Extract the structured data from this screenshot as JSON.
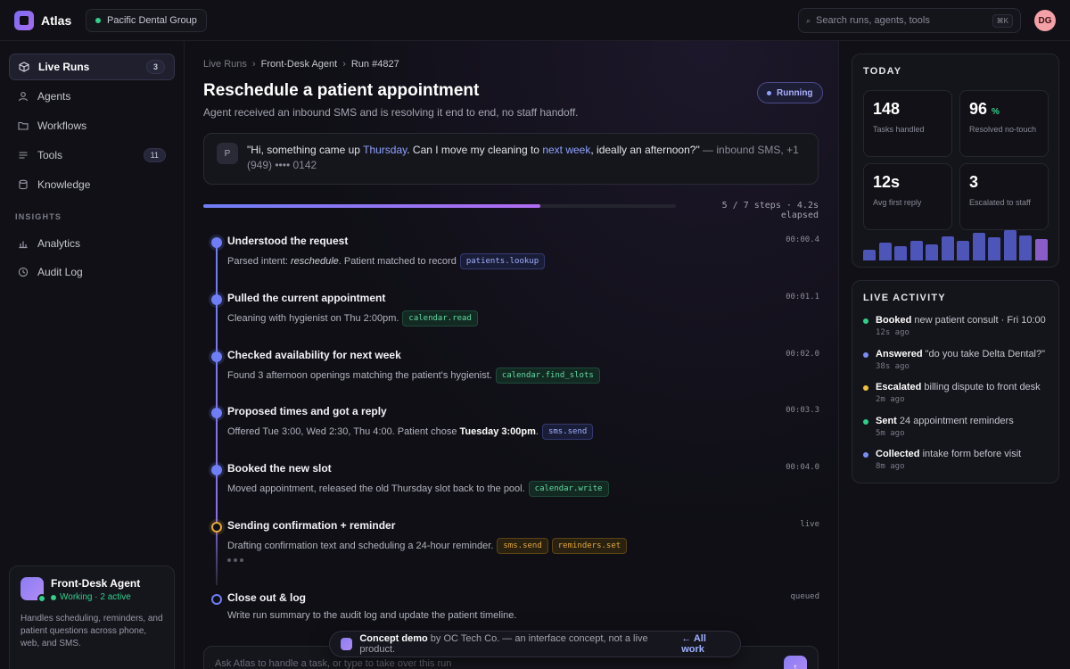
{
  "app": {
    "name": "Atlas",
    "avatar_initials": "DG"
  },
  "org": {
    "name": "Pacific Dental Group",
    "status_color": "#2fd08a"
  },
  "search": {
    "placeholder": "Search runs, agents, tools",
    "shortcut": "⌘K"
  },
  "sidebar": {
    "items": [
      {
        "label": "Live Runs",
        "icon": "cube-icon",
        "count": "3"
      },
      {
        "label": "Agents",
        "icon": "user-icon"
      },
      {
        "label": "Workflows",
        "icon": "folder-icon"
      },
      {
        "label": "Tools",
        "icon": "list-icon",
        "count": "11"
      },
      {
        "label": "Knowledge",
        "icon": "database-icon"
      }
    ],
    "section_insights": "INSIGHTS",
    "insights": [
      {
        "label": "Analytics",
        "icon": "bar-chart-icon"
      },
      {
        "label": "Audit Log",
        "icon": "clock-icon"
      }
    ],
    "agent_card": {
      "name": "Front-Desk Agent",
      "status": "Working · 2 active",
      "description": "Handles scheduling, reminders, and patient questions across phone, web, and SMS."
    }
  },
  "breadcrumb": [
    "Live Runs",
    "Front-Desk Agent",
    "Run #4827"
  ],
  "run": {
    "title": "Reschedule a patient appointment",
    "subtitle": "Agent received an inbound SMS and is resolving it end to end, no staff handoff.",
    "status": "Running",
    "message": {
      "avatar": "P",
      "part1": "\"Hi, something came up ",
      "hl1": "Thursday",
      "part2": ". Can I move my cleaning to ",
      "hl2": "next week",
      "part3": ", ideally an afternoon?\"",
      "meta": " — inbound SMS, +1 (949) •••• 0142"
    },
    "progress": {
      "value": 0.714,
      "text": "5 / 7 steps · 4.2s elapsed"
    }
  },
  "steps": [
    {
      "title": "Understood the request",
      "time": "00:00.4",
      "state": "done",
      "desc_pre": "Parsed intent: ",
      "desc_em": "reschedule",
      "desc_post": ". Patient matched to record",
      "chips": [
        {
          "label": "patients.lookup",
          "tone": "blue"
        }
      ]
    },
    {
      "title": "Pulled the current appointment",
      "time": "00:01.1",
      "state": "done",
      "desc_pre": "Cleaning with hygienist on Thu 2:00pm.",
      "chips": [
        {
          "label": "calendar.read",
          "tone": "green"
        }
      ]
    },
    {
      "title": "Checked availability for next week",
      "time": "00:02.0",
      "state": "done",
      "desc_pre": "Found 3 afternoon openings matching the patient's hygienist.",
      "chips": [
        {
          "label": "calendar.find_slots",
          "tone": "green"
        }
      ]
    },
    {
      "title": "Proposed times and got a reply",
      "time": "00:03.3",
      "state": "done",
      "desc_pre": "Offered Tue 3:00, Wed 2:30, Thu 4:00. Patient chose ",
      "desc_bold": "Tuesday 3:00pm",
      "desc_post": ".",
      "chips": [
        {
          "label": "sms.send",
          "tone": "blue"
        }
      ]
    },
    {
      "title": "Booked the new slot",
      "time": "00:04.0",
      "state": "done",
      "desc_pre": "Moved appointment, released the old Thursday slot back to the pool.",
      "chips": [
        {
          "label": "calendar.write",
          "tone": "green"
        }
      ]
    },
    {
      "title": "Sending confirmation + reminder",
      "time": "live",
      "state": "live",
      "desc_pre": "Drafting confirmation text and scheduling a 24-hour reminder.",
      "chips": [
        {
          "label": "sms.send",
          "tone": "amber"
        },
        {
          "label": "reminders.set",
          "tone": "amber"
        }
      ]
    },
    {
      "title": "Close out & log",
      "time": "queued",
      "state": "queued",
      "desc_pre": "Write run summary to the audit log and update the patient timeline.",
      "chips": []
    }
  ],
  "composer": {
    "placeholder": "Ask Atlas to handle a task, or type to take over this run"
  },
  "demo_banner": {
    "bold": "Concept demo",
    "text": " by OC Tech Co. — an interface concept, not a live product.",
    "link": "← All work"
  },
  "today": {
    "title": "TODAY",
    "stats": [
      {
        "value": "148",
        "label": "Tasks handled"
      },
      {
        "value": "96",
        "unit": "%",
        "label": "Resolved no-touch"
      },
      {
        "value": "12s",
        "label": "Avg first reply"
      },
      {
        "value": "3",
        "label": "Escalated to staff"
      }
    ],
    "bar_values": [
      0.33,
      0.55,
      0.45,
      0.62,
      0.5,
      0.75,
      0.6,
      0.85,
      0.72,
      0.95,
      0.78,
      0.68
    ],
    "bar_color": "#4e55b8",
    "bar_highlight_color": "#8a5cc8"
  },
  "live_activity": {
    "title": "LIVE ACTIVITY",
    "items": [
      {
        "bold": "Booked",
        "text": " new patient consult · Fri 10:00",
        "time": "12s ago",
        "color": "#2fd08a"
      },
      {
        "bold": "Answered",
        "text": " \"do you take Delta Dental?\"",
        "time": "38s ago",
        "color": "#7c8cf5"
      },
      {
        "bold": "Escalated",
        "text": " billing dispute to front desk",
        "time": "2m ago",
        "color": "#f2c13a"
      },
      {
        "bold": "Sent",
        "text": " 24 appointment reminders",
        "time": "5m ago",
        "color": "#2fd08a"
      },
      {
        "bold": "Collected",
        "text": " intake form before visit",
        "time": "8m ago",
        "color": "#7c8cf5"
      }
    ]
  }
}
